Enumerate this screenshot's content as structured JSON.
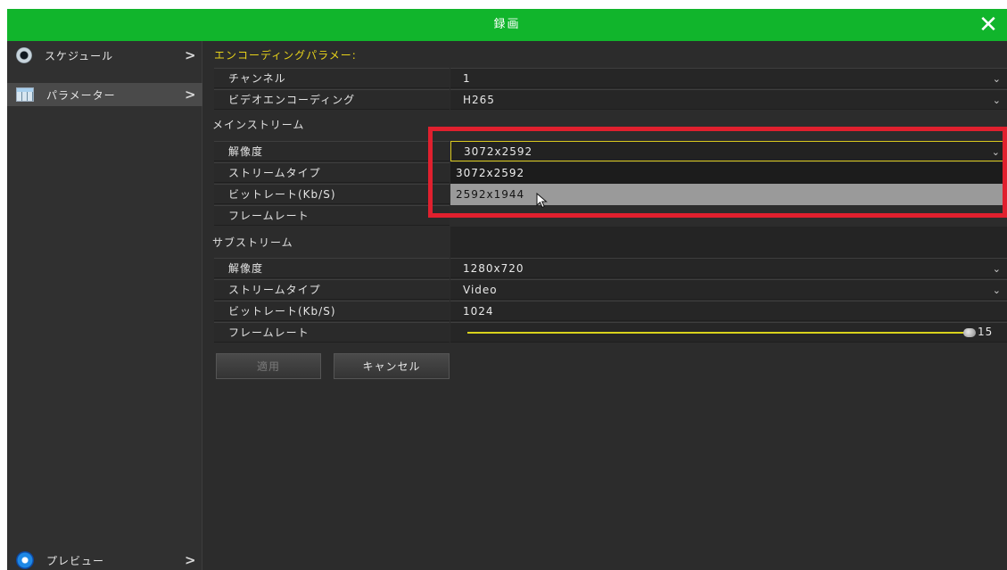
{
  "window": {
    "title": "録画",
    "close_glyph": "✕"
  },
  "sidebar": {
    "items": [
      {
        "label": "スケジュール",
        "icon": "record-disc-icon",
        "chevron": ">"
      },
      {
        "label": "パラメーター",
        "icon": "parameter-grid-icon",
        "chevron": ">"
      }
    ],
    "bottom": {
      "label": "プレビュー",
      "icon": "preview-icon",
      "chevron": ">"
    }
  },
  "encoding": {
    "section_title": "エンコーディングパラメー:",
    "channel_label": "チャンネル",
    "channel_value": "1",
    "video_encoding_label": "ビデオエンコーディング",
    "video_encoding_value": "H265"
  },
  "main_stream": {
    "section_title": "メインストリーム",
    "resolution_label": "解像度",
    "resolution_value": "3072x2592",
    "stream_type_label": "ストリームタイプ",
    "bitrate_label": "ビットレート(Kb/S)",
    "framerate_label": "フレームレート",
    "dropdown_options": [
      "3072x2592",
      "2592x1944"
    ]
  },
  "sub_stream": {
    "section_title": "サブストリーム",
    "resolution_label": "解像度",
    "resolution_value": "1280x720",
    "stream_type_label": "ストリームタイプ",
    "stream_type_value": "Video",
    "bitrate_label": "ビットレート(Kb/S)",
    "bitrate_value": "1024",
    "framerate_label": "フレームレート",
    "framerate_value": "15"
  },
  "buttons": {
    "apply": "適用",
    "cancel": "キャンセル"
  },
  "dropdown_glyph": "⌄",
  "colors": {
    "titlebar": "#11b52c",
    "highlight": "#e0202e",
    "accent_yellow": "#e7d21a"
  }
}
